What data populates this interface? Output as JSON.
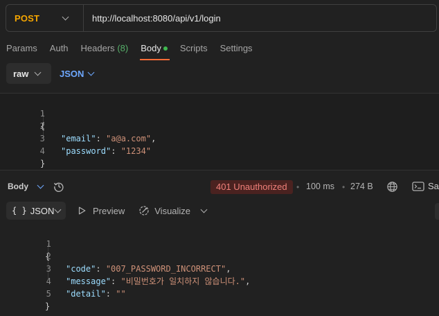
{
  "request": {
    "method": "POST",
    "url": "http://localhost:8080/api/v1/login"
  },
  "tabs": [
    {
      "label": "Params"
    },
    {
      "label": "Auth"
    },
    {
      "label": "Headers",
      "count": "(8)"
    },
    {
      "label": "Body"
    },
    {
      "label": "Scripts"
    },
    {
      "label": "Settings"
    }
  ],
  "body_mode": {
    "type": "raw",
    "language": "JSON"
  },
  "request_body": {
    "line_numbers": [
      "1",
      "2",
      "3",
      "4"
    ],
    "open_brace": "{",
    "close_brace": "}",
    "email_key": "\"email\"",
    "email_value": "\"a@a.com\"",
    "password_key": "\"password\"",
    "password_value": "\"1234\""
  },
  "response": {
    "section_label": "Body",
    "status": "401 Unauthorized",
    "time": "100 ms",
    "size": "274 B",
    "save_label": "Sa",
    "format": "JSON",
    "format_braces": "{ }",
    "preview_label": "Preview",
    "visualize_label": "Visualize"
  },
  "response_body": {
    "line_numbers": [
      "1",
      "2",
      "3",
      "4",
      "5"
    ],
    "open_brace": "{",
    "close_brace": "}",
    "code_key": "\"code\"",
    "code_value": "\"007_PASSWORD_INCORRECT\"",
    "message_key": "\"message\"",
    "message_value": "\"비밀번호가 일치하지 않습니다.\"",
    "detail_key": "\"detail\"",
    "detail_value": "\"\""
  },
  "colors": {
    "method": "#f6a600",
    "active_tab_underline": "#ff6c37",
    "status_bg": "#4a2220",
    "status_text": "#f0807a",
    "json_key": "#9cdcfe",
    "json_string": "#ce9178"
  },
  "icons": {
    "method_dropdown": "chevron-down-icon",
    "language_dropdown": "chevron-down-icon",
    "history": "history-icon",
    "network": "globe-icon",
    "save": "save-response-icon",
    "preview": "play-icon",
    "visualize": "visualize-icon"
  }
}
